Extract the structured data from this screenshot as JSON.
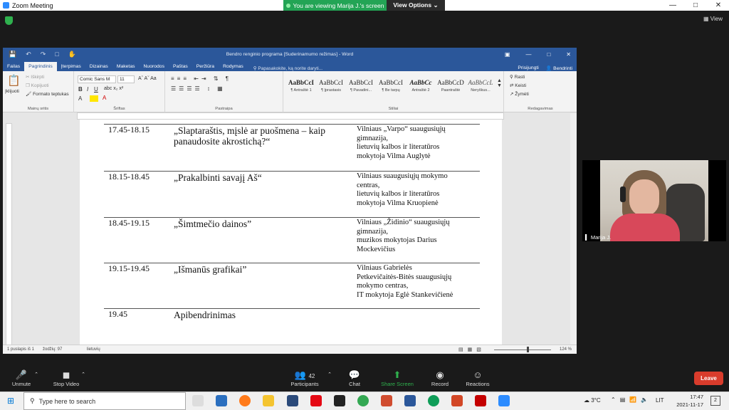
{
  "zoom": {
    "window_title": "Zoom Meeting",
    "banner": "You are viewing Marija J.'s screen",
    "view_options": "View Options ⌄",
    "view_label": "View",
    "participant_name": "Marija J.",
    "participants_count": "42",
    "toolbar": {
      "unmute": "Unmute",
      "stop_video": "Stop Video",
      "participants": "Participants",
      "chat": "Chat",
      "share_screen": "Share Screen",
      "record": "Record",
      "reactions": "Reactions",
      "leave": "Leave"
    },
    "colors": {
      "banner": "#23a455",
      "leave": "#d93c2c",
      "share": "#2fb14e"
    }
  },
  "word": {
    "doc_title": "Bendro renginio programa [Suderinamumo režimas] - Word",
    "tabs": [
      "Failas",
      "Pagrindinis",
      "Įterpimas",
      "Dizainas",
      "Maketas",
      "Nuorodos",
      "Paštas",
      "Peržiūra",
      "Rodymas"
    ],
    "selected_tab": "Pagrindinis",
    "tell_me": "Papasakokite, ką norite daryti...",
    "signin": "Prisijungti",
    "share": "Bendrinti",
    "clipboard": {
      "paste": "Įklijuoti",
      "cut": "Iškirpti",
      "copy": "Kopijuoti",
      "format_painter": "Formato teptukas",
      "label": "Mainų sritis"
    },
    "font": {
      "name": "Comic Sans M",
      "size": "11",
      "label": "Šriftas"
    },
    "paragraph_label": "Pastraipa",
    "styles": [
      {
        "preview": "AaBbCcI",
        "name": "¶ Antraštė 1"
      },
      {
        "preview": "AaBbCcI",
        "name": "¶ Įprastasis"
      },
      {
        "preview": "AaBbCcI",
        "name": "¶ Pavadini..."
      },
      {
        "preview": "AaBbCcI",
        "name": "¶ Be tarpų"
      },
      {
        "preview": "AaBbCc",
        "name": "Antraštė 2"
      },
      {
        "preview": "AaBbCcD",
        "name": "Paantraštė"
      },
      {
        "preview": "AaBbCcL",
        "name": "Neryškus..."
      }
    ],
    "styles_label": "Stiliai",
    "editing": {
      "find": "Rasti",
      "replace": "Keisti",
      "select": "Žymėti",
      "label": "Redagavimas"
    },
    "status": {
      "page": "1 puslapis iš 1",
      "words": "žodžių: 97",
      "language": "lietuvių",
      "zoom": "124 %"
    }
  },
  "document": {
    "rows": [
      {
        "time": "17.45-18.15",
        "topic": "„Slaptaraštis, mįslė ar puošmena – kaip panaudosite akrostichą?“",
        "org": [
          "Vilniaus „Varpo“ suaugusiųjų",
          "gimnazija,",
          "lietuvių kalbos ir literatūros",
          "mokytoja Vilma Auglytė"
        ]
      },
      {
        "time": "18.15-18.45",
        "topic": "„Prakalbinti savajį Aš“",
        "org": [
          "Vilniaus suaugusiųjų mokymo",
          "centras,",
          "lietuvių kalbos ir literatūros",
          "mokytoja Vilma Kruopienė"
        ]
      },
      {
        "time": "18.45-19.15",
        "topic": "„Šimtmečio dainos”",
        "org": [
          "Vilniaus „Židinio“ suaugusiųjų",
          "gimnazija,",
          "muzikos mokytojas Darius",
          "Mockevičius"
        ]
      },
      {
        "time": "19.15-19.45",
        "topic": "„Išmanūs grafikai”",
        "org": [
          "Vilniaus Gabrielės",
          "Petkevičaitės-Bitės suaugusiųjų",
          "mokymo centras,",
          "IT mokytoja Eglė Stankevičienė"
        ]
      },
      {
        "time": "19.45",
        "topic": "Apibendrinimas",
        "org": []
      }
    ]
  },
  "taskbar": {
    "search_placeholder": "Type here to search",
    "weather": "3°C",
    "language": "LIT",
    "time": "17:47",
    "date": "2021-11-17",
    "notifications": "2"
  }
}
